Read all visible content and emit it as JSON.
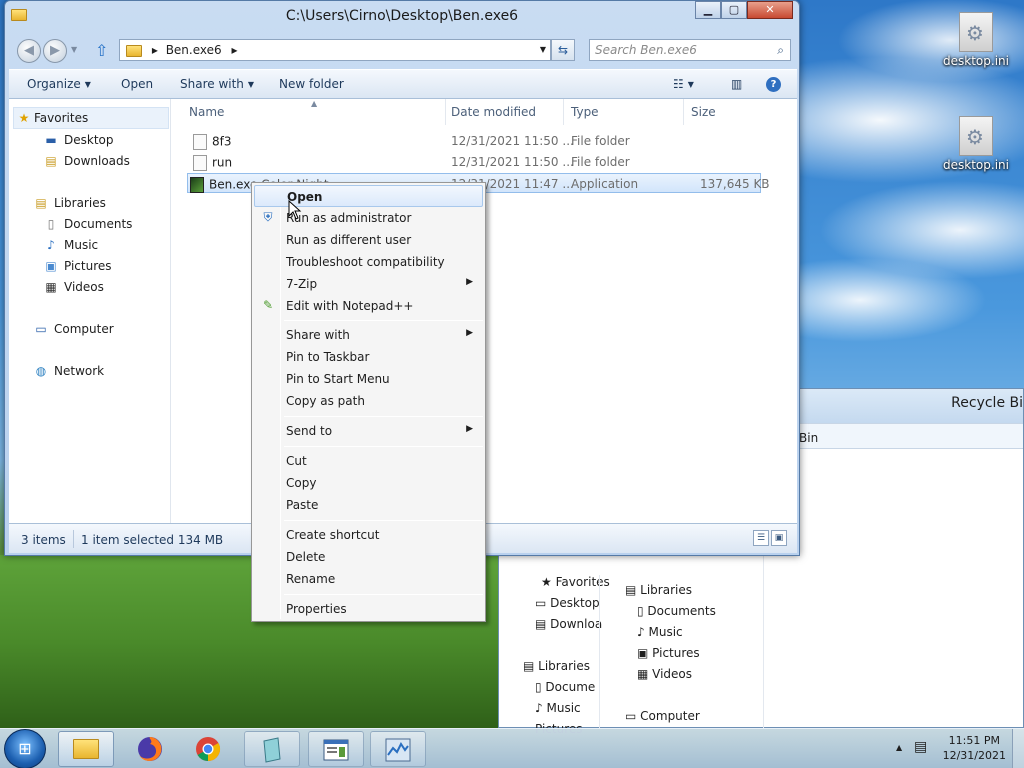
{
  "window": {
    "title": "C:\\Users\\Cirno\\Desktop\\Ben.exe6",
    "address_path": "Ben.exe6",
    "search_placeholder": "Search Ben.exe6"
  },
  "toolbar": {
    "organize": "Organize",
    "open": "Open",
    "share_with": "Share with",
    "new_folder": "New folder"
  },
  "sidebar": {
    "favorites": "Favorites",
    "desktop": "Desktop",
    "downloads": "Downloads",
    "libraries": "Libraries",
    "documents": "Documents",
    "music": "Music",
    "pictures": "Pictures",
    "videos": "Videos",
    "computer": "Computer",
    "network": "Network"
  },
  "columns": {
    "name": "Name",
    "date_modified": "Date modified",
    "type": "Type",
    "size": "Size"
  },
  "files": [
    {
      "name": "8f3",
      "date": "12/31/2021 11:50 ...",
      "type": "File folder",
      "size": ""
    },
    {
      "name": "run",
      "date": "12/31/2021 11:50 ...",
      "type": "File folder",
      "size": ""
    },
    {
      "name": "Ben.exe",
      "name_hidden": "Color Night",
      "date": "12/31/2021 11:47 ...",
      "type": "Application",
      "size": "137,645 KB"
    }
  ],
  "status": {
    "items": "3 items",
    "selected": "1 item selected  134 MB"
  },
  "context_menu": {
    "open": "Open",
    "run_as_admin": "Run as administrator",
    "run_as_user": "Run as different user",
    "troubleshoot": "Troubleshoot compatibility",
    "zip": "7-Zip",
    "notepad": "Edit with Notepad++",
    "share_with": "Share with",
    "pin_taskbar": "Pin to Taskbar",
    "pin_start": "Pin to Start Menu",
    "copy_path": "Copy as path",
    "send_to": "Send to",
    "cut": "Cut",
    "copy": "Copy",
    "paste": "Paste",
    "create_shortcut": "Create shortcut",
    "delete": "Delete",
    "rename": "Rename",
    "properties": "Properties"
  },
  "desktop_icons": {
    "ini1": "desktop.ini",
    "ini2": "desktop.ini"
  },
  "bg_window": {
    "title": "Recycle Bi",
    "addr": "Bin",
    "favorites": "Favorites",
    "desktop": "Desktop",
    "downloads": "Downloa",
    "libraries": "Libraries",
    "documents": "Docume",
    "music": "Music",
    "pictures": "Pictures",
    "lib2": "Libraries",
    "doc2": "Documents",
    "music2": "Music",
    "pictures2": "Pictures",
    "videos2": "Videos",
    "computer2": "Computer"
  },
  "clock": {
    "time": "11:51 PM",
    "date": "12/31/2021"
  }
}
